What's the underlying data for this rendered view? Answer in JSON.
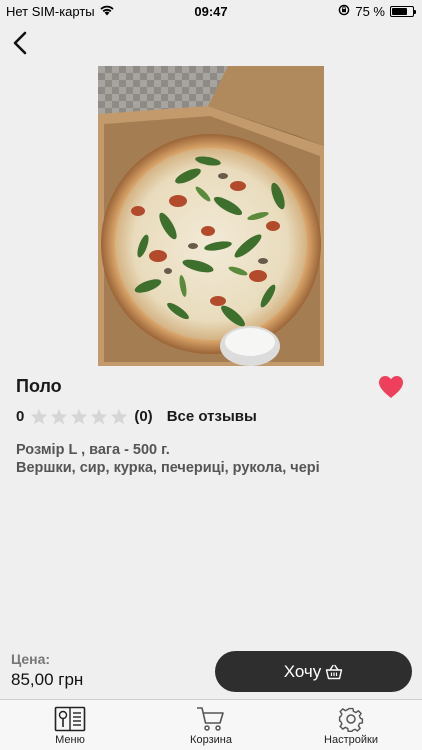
{
  "status_bar": {
    "carrier": "Нет SIM-карты",
    "time": "09:47",
    "battery_text": "75 %",
    "battery_level": 0.75
  },
  "product": {
    "name": "Поло",
    "rating": "0",
    "stars_filled": 0,
    "stars_total": 5,
    "review_count": "(0)",
    "reviews_link": "Все отзывы",
    "size_weight": "Розмір L , вага - 500 г.",
    "ingredients": "Вершки, сир, курка, печериці, рукола, чері",
    "favorite": true,
    "favorite_color": "#ee3f5d"
  },
  "purchase": {
    "price_label": "Цена:",
    "price": "85,00 грн",
    "button_label": "Хочу",
    "button_color": "#2e2e2e"
  },
  "tabs": [
    {
      "label": "Меню",
      "icon": "menu-book-icon"
    },
    {
      "label": "Корзина",
      "icon": "cart-icon"
    },
    {
      "label": "Настройки",
      "icon": "gear-icon"
    }
  ]
}
